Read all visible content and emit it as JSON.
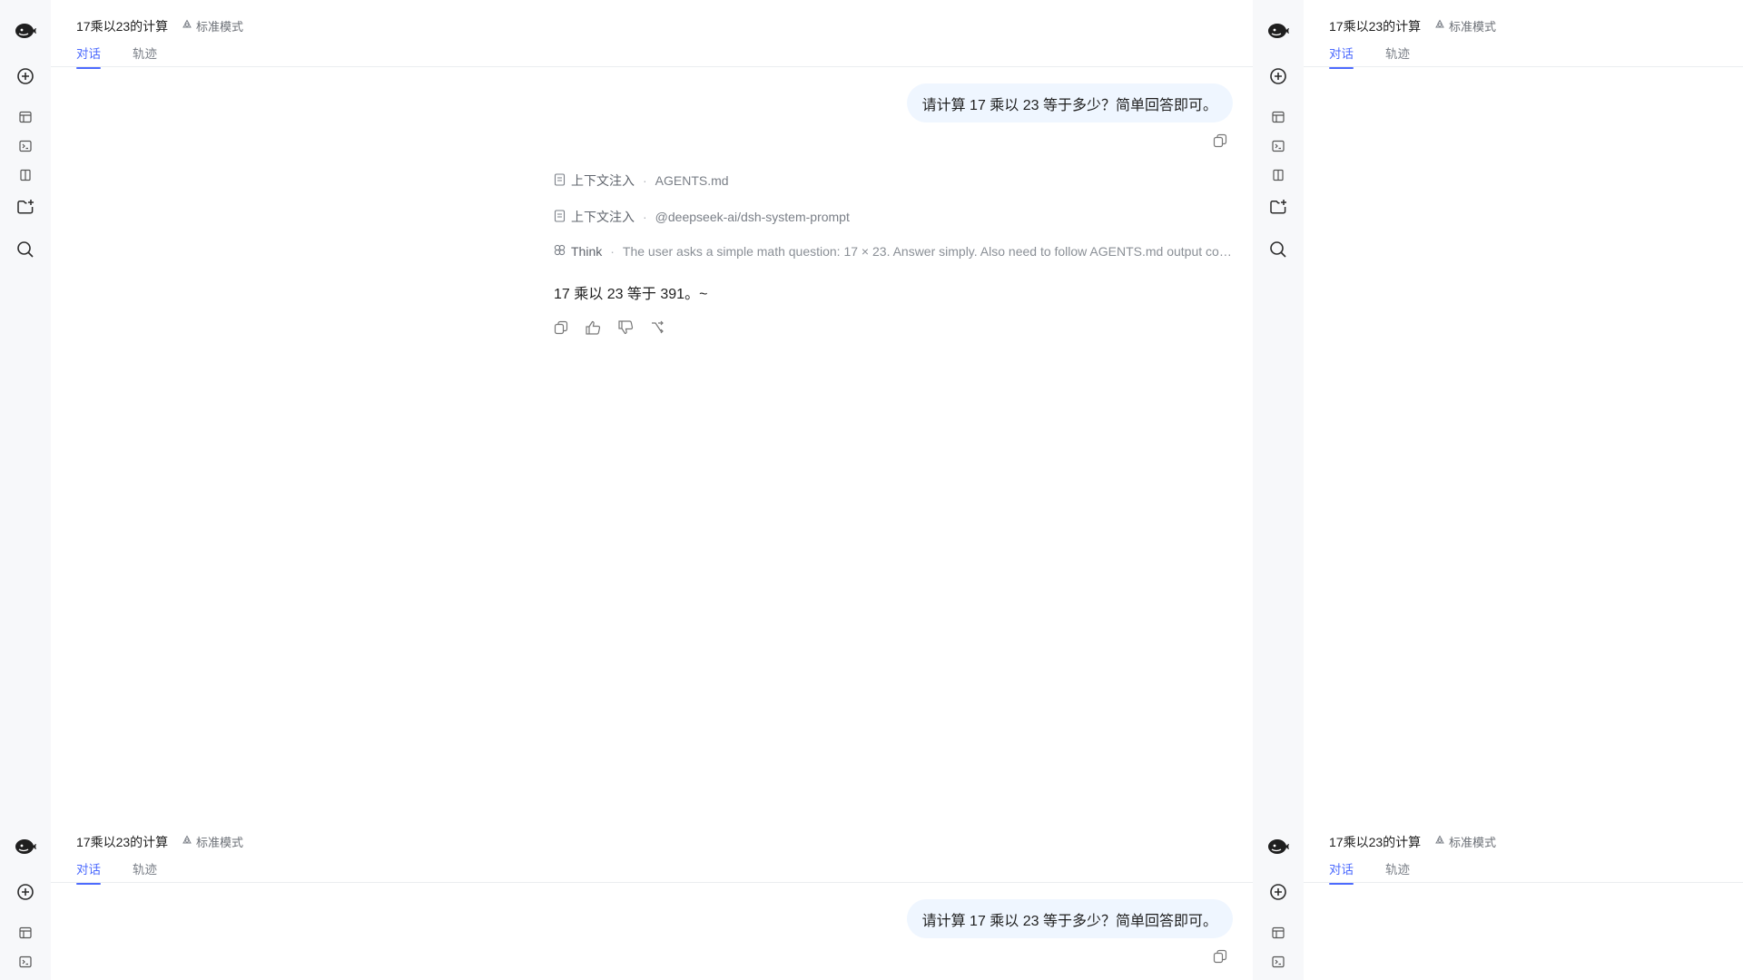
{
  "rail": {
    "logo": "deepseek-whale-icon",
    "items": [
      "new-chat-icon",
      "panel-icon",
      "terminal-icon",
      "book-icon",
      "add-folder-icon",
      "search-icon"
    ]
  },
  "header": {
    "title": "17乘以23的计算",
    "mode": "标准模式",
    "tabs": [
      "对话",
      "轨迹"
    ]
  },
  "chat": {
    "user_message": "请计算 17 乘以 23 等于多少？简单回答即可。",
    "context_label": "上下文注入",
    "context_1": "AGENTS.md",
    "context_2": "@deepseek-ai/dsh-system-prompt",
    "think_label": "Think",
    "think_text": "The user asks a simple math question: 17 × 23. Answer simply. Also need to follow AGENTS.md output conv...",
    "answer": "17 乘以 23 等于 391。~"
  },
  "colors": {
    "accent": "#4d6bfe",
    "bubble": "#eff6ff",
    "rail": "#f7f8fa"
  }
}
